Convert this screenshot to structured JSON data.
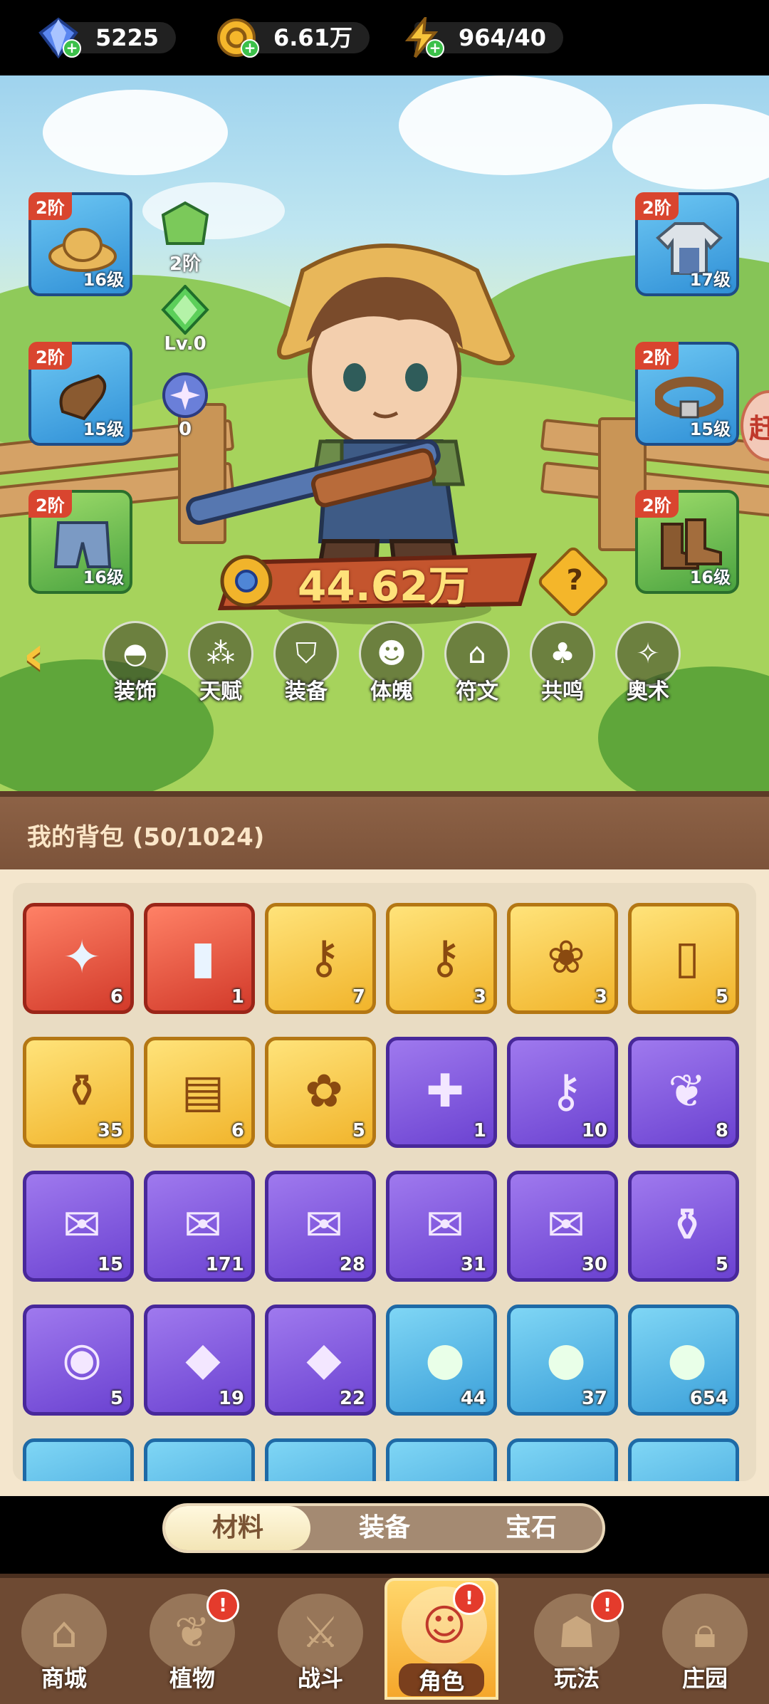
{
  "currencies": [
    {
      "icon": "diamond-icon",
      "value": "5225",
      "color": "#4a7be8"
    },
    {
      "icon": "gold-coin-icon",
      "value": "6.61万",
      "color": "#f5b72b"
    },
    {
      "icon": "energy-bolt-icon",
      "value": "964/40",
      "color": "#f7c43b"
    }
  ],
  "equipment_left": [
    {
      "tier": "2阶",
      "level": "16级",
      "icon": "straw-hat-icon"
    },
    {
      "tier": "2阶",
      "level": "15级",
      "icon": "gloves-icon"
    },
    {
      "tier": "2阶",
      "level": "16级",
      "icon": "pants-icon"
    }
  ],
  "equipment_right": [
    {
      "tier": "2阶",
      "level": "17级",
      "icon": "shirt-icon"
    },
    {
      "tier": "2阶",
      "level": "15级",
      "icon": "belt-icon"
    },
    {
      "tier": "2阶",
      "level": "16级",
      "icon": "boots-icon"
    }
  ],
  "mini_stats": [
    {
      "icon": "green-badge-icon",
      "value": "2阶"
    },
    {
      "icon": "green-gem-icon",
      "value": "Lv.0"
    },
    {
      "icon": "sparkle-orb-icon",
      "value": "0"
    }
  ],
  "power": {
    "value": "44.62万",
    "help": "?"
  },
  "edge_button": "赶",
  "nav": {
    "back": "‹",
    "items": [
      {
        "label": "装饰",
        "icon": "mask-icon"
      },
      {
        "label": "天赋",
        "icon": "talent-icon"
      },
      {
        "label": "装备",
        "icon": "equipment-icon"
      },
      {
        "label": "体魄",
        "icon": "physique-icon"
      },
      {
        "label": "符文",
        "icon": "rune-icon"
      },
      {
        "label": "共鸣",
        "icon": "resonance-icon"
      },
      {
        "label": "奥术",
        "icon": "arcane-icon"
      }
    ]
  },
  "bag": {
    "title": "我的背包 (50/1024)",
    "items": [
      {
        "rarity": "red",
        "icon": "crystal-star-icon",
        "glyph": "✦",
        "qty": "6"
      },
      {
        "rarity": "red",
        "icon": "green-canister-icon",
        "glyph": "▮",
        "qty": "1"
      },
      {
        "rarity": "gold",
        "icon": "gold-key-icon",
        "glyph": "⚷",
        "qty": "7"
      },
      {
        "rarity": "gold",
        "icon": "gem-key-icon",
        "glyph": "⚷",
        "qty": "3"
      },
      {
        "rarity": "gold",
        "icon": "golden-bulb-icon",
        "glyph": "❀",
        "qty": "3"
      },
      {
        "rarity": "gold",
        "icon": "red-can-icon",
        "glyph": "▯",
        "qty": "5"
      },
      {
        "rarity": "gold",
        "icon": "orange-potion-icon",
        "glyph": "⚱",
        "qty": "35"
      },
      {
        "rarity": "gold",
        "icon": "spell-book-icon",
        "glyph": "▤",
        "qty": "6"
      },
      {
        "rarity": "gold",
        "icon": "golden-flower-icon",
        "glyph": "✿",
        "qty": "5"
      },
      {
        "rarity": "purple",
        "icon": "green-ticket-icon",
        "glyph": "✚",
        "qty": "1"
      },
      {
        "rarity": "purple",
        "icon": "silver-key-icon",
        "glyph": "⚷",
        "qty": "10"
      },
      {
        "rarity": "purple",
        "icon": "blue-leaf-icon",
        "glyph": "❦",
        "qty": "8"
      },
      {
        "rarity": "purple",
        "icon": "green-scroll-icon",
        "glyph": "✉",
        "qty": "15"
      },
      {
        "rarity": "purple",
        "icon": "purple-scroll-icon",
        "glyph": "✉",
        "qty": "171"
      },
      {
        "rarity": "purple",
        "icon": "blue-scroll-icon",
        "glyph": "✉",
        "qty": "28"
      },
      {
        "rarity": "purple",
        "icon": "red-scroll-icon",
        "glyph": "✉",
        "qty": "31"
      },
      {
        "rarity": "purple",
        "icon": "bolt-scroll-icon",
        "glyph": "✉",
        "qty": "30"
      },
      {
        "rarity": "purple",
        "icon": "purple-potion-icon",
        "glyph": "⚱",
        "qty": "5"
      },
      {
        "rarity": "purple",
        "icon": "amber-drop-icon",
        "glyph": "◉",
        "qty": "5"
      },
      {
        "rarity": "purple",
        "icon": "pink-crystal-icon",
        "glyph": "◆",
        "qty": "19"
      },
      {
        "rarity": "purple",
        "icon": "blue-crystal-icon",
        "glyph": "◆",
        "qty": "22"
      },
      {
        "rarity": "blue",
        "icon": "green-sword-orb-icon",
        "glyph": "●",
        "qty": "44"
      },
      {
        "rarity": "blue",
        "icon": "pink-potion-orb-icon",
        "glyph": "●",
        "qty": "37"
      },
      {
        "rarity": "blue",
        "icon": "blue-swirl-orb-icon",
        "glyph": "●",
        "qty": "654"
      }
    ],
    "partial_row": [
      {
        "rarity": "blue",
        "icon": "orange-fruit-icon"
      },
      {
        "rarity": "blue",
        "icon": "yellow-fruit-icon"
      },
      {
        "rarity": "blue",
        "icon": "potion-bottle-icon"
      },
      {
        "rarity": "blue",
        "icon": "map-scroll-icon"
      },
      {
        "rarity": "blue",
        "icon": "map-scroll-icon"
      },
      {
        "rarity": "blue",
        "icon": "map-scroll-icon"
      }
    ]
  },
  "tabs": [
    {
      "label": "材料",
      "active": true
    },
    {
      "label": "装备",
      "active": false
    },
    {
      "label": "宝石",
      "active": false
    }
  ],
  "bottom_nav": [
    {
      "label": "商城",
      "icon": "shop-icon",
      "alert": false,
      "active": false
    },
    {
      "label": "植物",
      "icon": "plant-icon",
      "alert": true,
      "active": false
    },
    {
      "label": "战斗",
      "icon": "battle-icon",
      "alert": false,
      "active": false
    },
    {
      "label": "角色",
      "icon": "character-icon",
      "alert": true,
      "active": true
    },
    {
      "label": "玩法",
      "icon": "gameplay-icon",
      "alert": true,
      "active": false
    },
    {
      "label": "庄园",
      "icon": "manor-lock-icon",
      "alert": false,
      "active": false
    }
  ]
}
